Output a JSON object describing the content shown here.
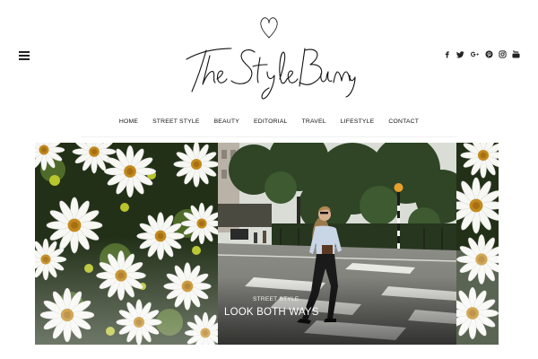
{
  "brand": {
    "logo_text": "The Style Bunny"
  },
  "header": {
    "menu_icon": "hamburger-menu-icon",
    "social_icons": [
      "facebook-icon",
      "twitter-icon",
      "google-plus-icon",
      "pinterest-icon",
      "instagram-icon",
      "youtube-icon"
    ]
  },
  "nav": {
    "items": [
      "HOME",
      "STREET STYLE",
      "BEAUTY",
      "EDITORIAL",
      "TRAVEL",
      "LIFESTYLE",
      "CONTACT"
    ]
  },
  "featured": {
    "category": "STREET STYLE",
    "title": "LOOK BOTH WAYS"
  },
  "colors": {
    "text": "#111111",
    "background": "#ffffff",
    "caption": "#ffffff"
  }
}
